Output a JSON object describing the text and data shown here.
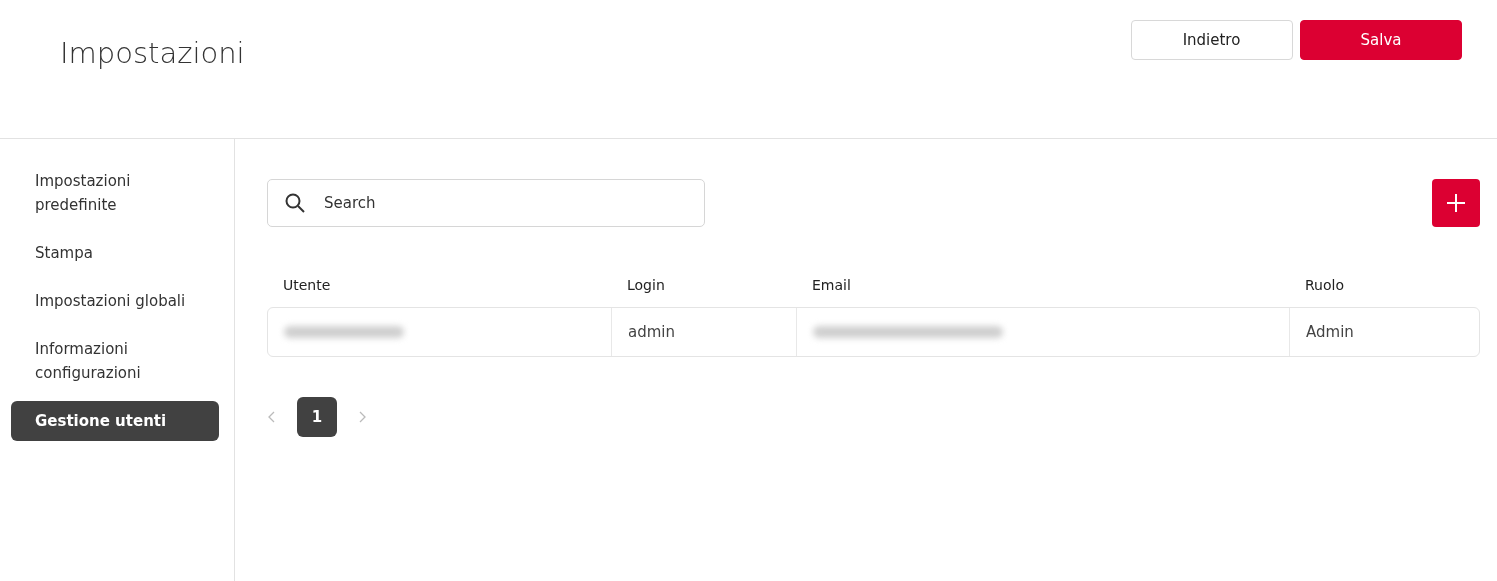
{
  "page": {
    "title": "Impostazioni"
  },
  "header_buttons": [
    {
      "label": "Indietro",
      "kind": "secondary"
    },
    {
      "label": "Salva",
      "kind": "primary"
    }
  ],
  "sidebar": {
    "items": [
      {
        "label": "Impostazioni predefinite",
        "selected": false
      },
      {
        "label": "Stampa",
        "selected": false
      },
      {
        "label": "Impostazioni globali",
        "selected": false
      },
      {
        "label": "Informazioni configurazioni",
        "selected": false
      },
      {
        "label": "Gestione utenti",
        "selected": true
      }
    ]
  },
  "search": {
    "placeholder": "Search"
  },
  "table": {
    "columns": [
      "Utente",
      "Login",
      "Email",
      "Ruolo"
    ],
    "rows": [
      {
        "cells": [
          {
            "redacted": true
          },
          {
            "text": "admin"
          },
          {
            "redacted": true
          },
          {
            "text": "Admin"
          }
        ]
      }
    ]
  },
  "pagination": {
    "pages": [
      {
        "label": "1",
        "selected": true
      }
    ],
    "prev_disabled": true,
    "next_disabled": true
  }
}
